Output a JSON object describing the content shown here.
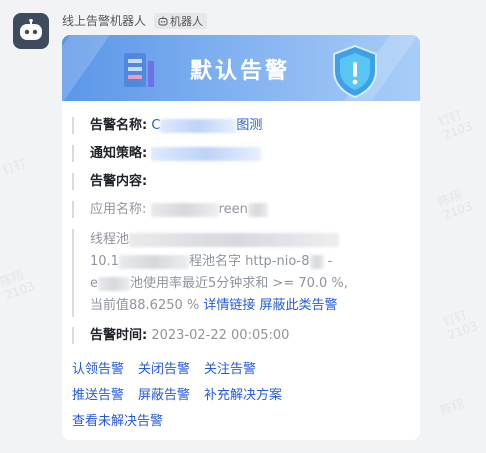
{
  "sender": {
    "name": "线上告警机器人",
    "tag": "机器人"
  },
  "banner": {
    "title": "默认告警"
  },
  "fields": {
    "alert_name_label": "告警名称:",
    "alert_name_value_prefix": "C",
    "alert_name_value_suffix": "图测",
    "policy_label": "通知策略:",
    "content_label": "告警内容:",
    "app_label": "应用名称:",
    "app_value_fragment": "reen",
    "msg_line1_prefix": "线程池",
    "msg_line2_prefix": "10.1",
    "msg_line2_middle": "程池名字",
    "msg_line2_fragment": "http-nio-8",
    "msg_line2_end": "-",
    "msg_line3_prefix": "e",
    "msg_line3_text": "池使用率最近5分钟求和 >= 70.0 %,",
    "msg_line4_text": "当前值88.6250 %",
    "detail_link": "详情链接",
    "block_similar_link": "屏蔽此类告警",
    "time_label": "告警时间:",
    "time_value": "2023-02-22 00:05:00"
  },
  "actions": {
    "row1": [
      "认领告警",
      "关闭告警",
      "关注告警"
    ],
    "row2": [
      "推送告警",
      "屏蔽告警",
      "补充解决方案"
    ],
    "row3": [
      "查看未解决告警"
    ]
  },
  "colors": {
    "link": "#245bdb",
    "avatar_bg": "#3d4b5c",
    "banner": "#5b96e8"
  }
}
